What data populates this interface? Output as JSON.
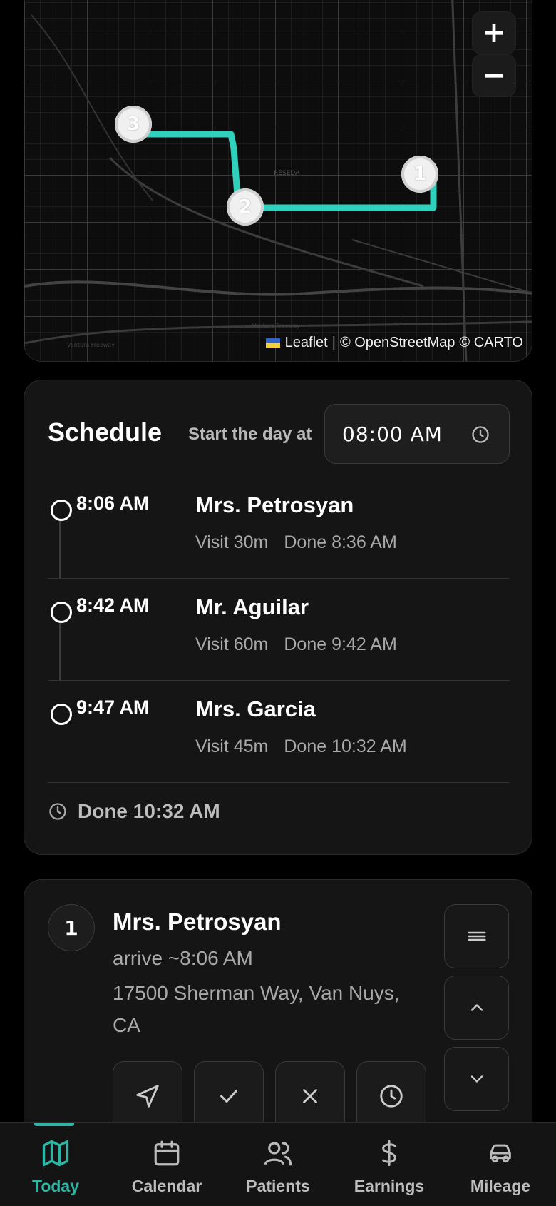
{
  "map": {
    "zoom_in_label": "+",
    "zoom_out_label": "−",
    "markers": [
      "1",
      "2",
      "3"
    ],
    "place_label": "RESEDA",
    "road_label_1": "Ventura Freeway",
    "road_label_2": "Ventura Freeway",
    "attribution": {
      "leaflet": "Leaflet",
      "sep": "|",
      "osm": "© OpenStreetMap",
      "carto": "© CARTO"
    },
    "route_color": "#2fd1bd"
  },
  "schedule": {
    "title": "Schedule",
    "start_label": "Start the day at",
    "start_time": "08:00 AM",
    "visits": [
      {
        "time": "8:06 AM",
        "name": "Mrs. Petrosyan",
        "visit": "Visit 30m",
        "done": "Done 8:36 AM"
      },
      {
        "time": "8:42 AM",
        "name": "Mr. Aguilar",
        "visit": "Visit 60m",
        "done": "Done 9:42 AM"
      },
      {
        "time": "9:47 AM",
        "name": "Mrs. Garcia",
        "visit": "Visit 45m",
        "done": "Done 10:32 AM"
      }
    ],
    "done_total": "Done 10:32 AM"
  },
  "patient_card": {
    "number": "1",
    "name": "Mrs. Petrosyan",
    "arrive": "arrive ~8:06 AM",
    "address": "17500 Sherman Way, Van Nuys, CA",
    "side_icons": [
      "drag-handle-icon",
      "chevron-up-icon",
      "chevron-down-icon"
    ],
    "action_icons": [
      "navigate-icon",
      "check-icon",
      "close-icon",
      "clock-icon"
    ]
  },
  "nav": {
    "items": [
      {
        "label": "Today",
        "icon": "map-icon",
        "active": true
      },
      {
        "label": "Calendar",
        "icon": "calendar-icon",
        "active": false
      },
      {
        "label": "Patients",
        "icon": "users-icon",
        "active": false
      },
      {
        "label": "Earnings",
        "icon": "dollar-icon",
        "active": false
      },
      {
        "label": "Mileage",
        "icon": "car-icon",
        "active": false
      }
    ],
    "accent": "#2bb7a6"
  }
}
